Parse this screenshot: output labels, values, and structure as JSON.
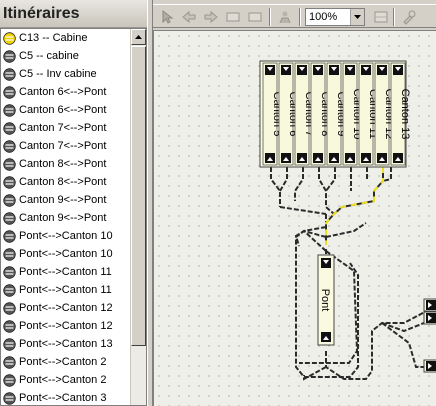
{
  "panel": {
    "title": "Itinéraires",
    "items": [
      {
        "label": "C13 -- Cabine",
        "color": "#f2d200"
      },
      {
        "label": "C5 -- cabine",
        "color": "#555555"
      },
      {
        "label": "C5 -- Inv cabine",
        "color": "#555555"
      },
      {
        "label": "Canton 6<-->Pont",
        "color": "#555555"
      },
      {
        "label": "Canton 6<-->Pont",
        "color": "#555555"
      },
      {
        "label": "Canton 7<-->Pont",
        "color": "#555555"
      },
      {
        "label": "Canton 7<-->Pont",
        "color": "#555555"
      },
      {
        "label": "Canton 8<-->Pont",
        "color": "#555555"
      },
      {
        "label": "Canton 8<-->Pont",
        "color": "#555555"
      },
      {
        "label": "Canton 9<-->Pont",
        "color": "#555555"
      },
      {
        "label": "Canton 9<-->Pont",
        "color": "#555555"
      },
      {
        "label": "Pont<-->Canton 10",
        "color": "#555555"
      },
      {
        "label": "Pont<-->Canton 10",
        "color": "#555555"
      },
      {
        "label": "Pont<-->Canton 11",
        "color": "#555555"
      },
      {
        "label": "Pont<-->Canton 11",
        "color": "#555555"
      },
      {
        "label": "Pont<-->Canton 12",
        "color": "#555555"
      },
      {
        "label": "Pont<-->Canton 12",
        "color": "#555555"
      },
      {
        "label": "Pont<-->Canton 13",
        "color": "#555555"
      },
      {
        "label": "Pont<-->Canton 2",
        "color": "#555555"
      },
      {
        "label": "Pont<-->Canton 2",
        "color": "#555555"
      },
      {
        "label": "Pont<-->Canton 3",
        "color": "#555555"
      }
    ]
  },
  "toolbar": {
    "zoom_value": "100%",
    "buttons": [
      "select-icon",
      "back-icon",
      "forward-icon",
      "rect-icon",
      "rect-icon",
      "person-icon",
      "grid-icon",
      "tools-icon"
    ]
  },
  "diagram": {
    "tracks": [
      "Canton 5",
      "Canton 6",
      "Canton 7",
      "Canton 8",
      "Canton 9",
      "Canton 10",
      "Canton 11",
      "Canton 12",
      "Canton 13"
    ],
    "bridge": "Pont",
    "highlight_color": "#f0e020"
  }
}
